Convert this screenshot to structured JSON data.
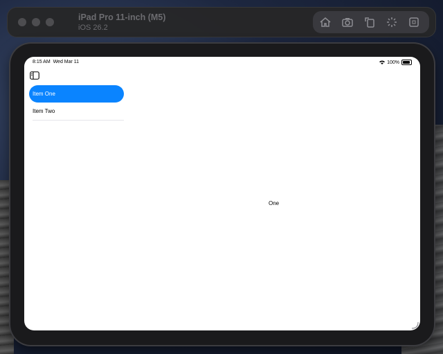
{
  "simulator": {
    "device_name": "iPad Pro 11-inch (M5)",
    "os_version": "iOS 26.2",
    "tools": [
      {
        "icon": "home-icon"
      },
      {
        "icon": "screenshot-icon"
      },
      {
        "icon": "rotate-icon"
      },
      {
        "icon": "shake-icon"
      },
      {
        "icon": "keyboard-icon"
      }
    ]
  },
  "status_bar": {
    "time": "8:15 AM",
    "date": "Wed Mar 11",
    "battery": "100%"
  },
  "sidebar": {
    "items": [
      {
        "label": "Item One",
        "selected": true
      },
      {
        "label": "Item Two",
        "selected": false
      }
    ]
  },
  "detail": {
    "text": "One"
  },
  "colors": {
    "accent": "#0a84ff",
    "toolbar": "#262628"
  }
}
